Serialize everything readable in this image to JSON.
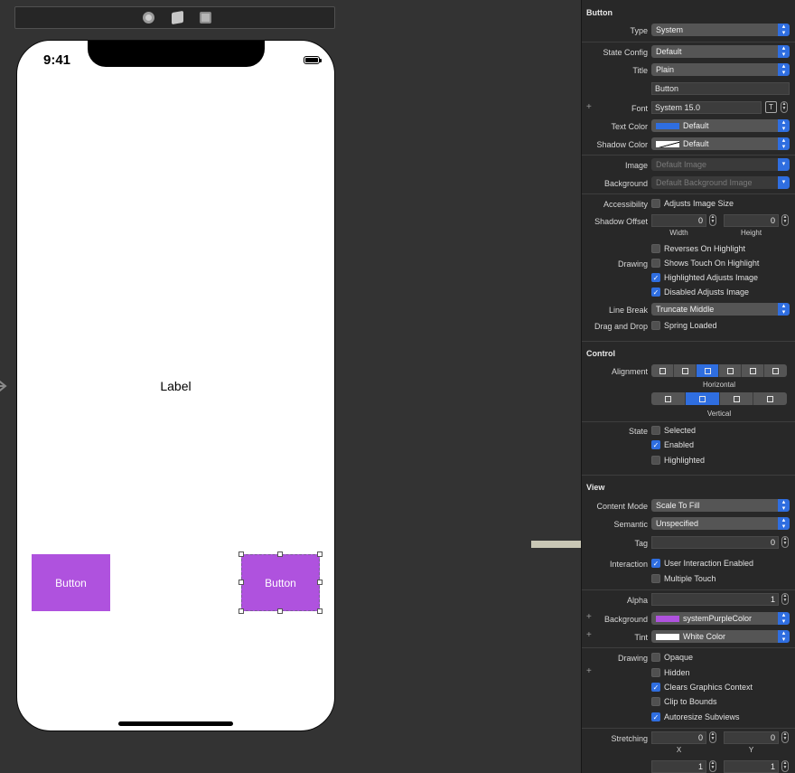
{
  "device": {
    "status_time": "9:41",
    "center_label": "Label",
    "left_button_label": "Button",
    "right_button_label": "Button"
  },
  "inspector": {
    "button": {
      "title": "Button",
      "type": {
        "label": "Type",
        "value": "System"
      },
      "state_config": {
        "label": "State Config",
        "value": "Default"
      },
      "title_style": {
        "label": "Title",
        "value": "Plain"
      },
      "title_text": "Button",
      "font": {
        "label": "Font",
        "value": "System 15.0"
      },
      "text_color": {
        "label": "Text Color",
        "value": "Default",
        "swatch": "#2f6ee0"
      },
      "shadow_color": {
        "label": "Shadow Color",
        "value": "Default"
      },
      "image": {
        "label": "Image",
        "placeholder": "Default Image"
      },
      "background": {
        "label": "Background",
        "placeholder": "Default Background Image"
      },
      "accessibility": {
        "label": "Accessibility",
        "option": "Adjusts Image Size",
        "checked": false
      },
      "shadow_offset": {
        "label": "Shadow Offset",
        "width": "0",
        "height": "0",
        "width_caption": "Width",
        "height_caption": "Height"
      },
      "drawing": {
        "label": "Drawing",
        "options": [
          {
            "text": "Reverses On Highlight",
            "checked": false
          },
          {
            "text": "Shows Touch On Highlight",
            "checked": false
          },
          {
            "text": "Highlighted Adjusts Image",
            "checked": true
          },
          {
            "text": "Disabled Adjusts Image",
            "checked": true
          }
        ]
      },
      "line_break": {
        "label": "Line Break",
        "value": "Truncate Middle"
      },
      "drag_drop": {
        "label": "Drag and Drop",
        "option": "Spring Loaded",
        "checked": false
      }
    },
    "control": {
      "title": "Control",
      "alignment_label": "Alignment",
      "horizontal_caption": "Horizontal",
      "vertical_caption": "Vertical",
      "horizontal_selected_index": 2,
      "vertical_selected_index": 1,
      "state_label": "State",
      "states": [
        {
          "text": "Selected",
          "checked": false
        },
        {
          "text": "Enabled",
          "checked": true
        },
        {
          "text": "Highlighted",
          "checked": false
        }
      ]
    },
    "view": {
      "title": "View",
      "content_mode": {
        "label": "Content Mode",
        "value": "Scale To Fill"
      },
      "semantic": {
        "label": "Semantic",
        "value": "Unspecified"
      },
      "tag": {
        "label": "Tag",
        "value": "0"
      },
      "interaction": {
        "label": "Interaction",
        "options": [
          {
            "text": "User Interaction Enabled",
            "checked": true
          },
          {
            "text": "Multiple Touch",
            "checked": false
          }
        ]
      },
      "alpha": {
        "label": "Alpha",
        "value": "1"
      },
      "background": {
        "label": "Background",
        "value": "systemPurpleColor",
        "swatch": "#af52de"
      },
      "tint": {
        "label": "Tint",
        "value": "White Color",
        "swatch": "#ffffff"
      },
      "drawing": {
        "label": "Drawing",
        "options": [
          {
            "text": "Opaque",
            "checked": false
          },
          {
            "text": "Hidden",
            "checked": false
          },
          {
            "text": "Clears Graphics Context",
            "checked": true
          },
          {
            "text": "Clip to Bounds",
            "checked": false
          },
          {
            "text": "Autoresize Subviews",
            "checked": true
          }
        ]
      },
      "stretching": {
        "label": "Stretching",
        "x": "0",
        "y": "0",
        "x_caption": "X",
        "y_caption": "Y",
        "w": "1",
        "h": "1"
      }
    }
  },
  "colors": {
    "accent": "#2f6ee0",
    "button_purple": "#af52de"
  }
}
